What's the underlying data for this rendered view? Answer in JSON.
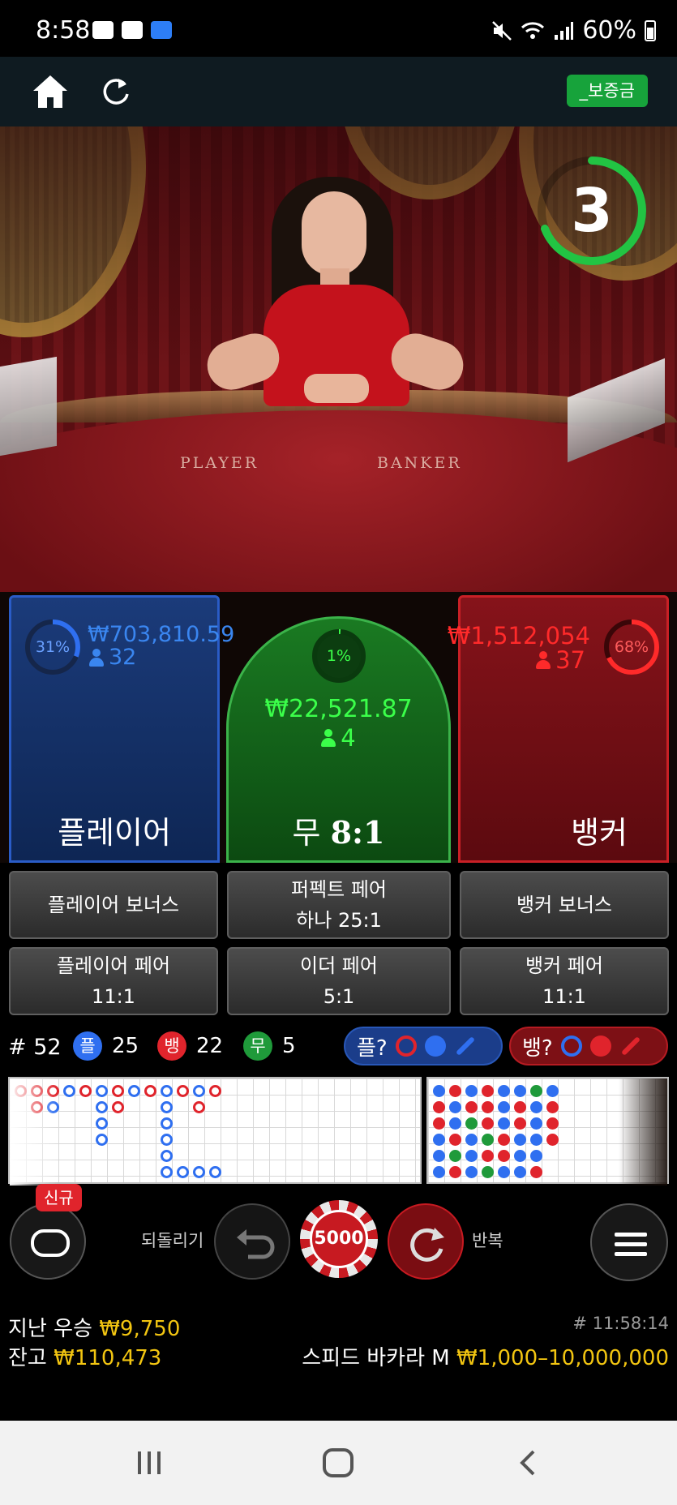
{
  "status_bar": {
    "time": "8:58",
    "battery": "60%"
  },
  "header": {
    "deposit_label": "_보증금"
  },
  "video": {
    "felt_player": "PLAYER",
    "felt_banker": "BANKER",
    "countdown": "3"
  },
  "bets": {
    "player": {
      "percent": "31%",
      "percent_value": 0.31,
      "amount": "₩703,810.59",
      "people": "32",
      "label": "플레이어"
    },
    "tie": {
      "percent": "1%",
      "percent_value": 0.01,
      "amount": "₩22,521.87",
      "people": "4",
      "label": "무",
      "ratio": "8:1"
    },
    "banker": {
      "percent": "68%",
      "percent_value": 0.68,
      "amount": "₩1,512,054",
      "people": "37",
      "label": "뱅커"
    }
  },
  "side_bets": {
    "player_bonus": "플레이어 보너스",
    "perfect_pair_line1": "퍼펙트 페어",
    "perfect_pair_line2": "하나 25:1",
    "banker_bonus": "뱅커 보너스",
    "player_pair_line1": "플레이어 페어",
    "player_pair_line2": "11:1",
    "either_pair_line1": "이더 페어",
    "either_pair_line2": "5:1",
    "banker_pair_line1": "뱅커 페어",
    "banker_pair_line2": "11:1"
  },
  "stats": {
    "round": "# 52",
    "player_glyph": "플",
    "player_count": "25",
    "banker_glyph": "뱅",
    "banker_count": "22",
    "tie_glyph": "무",
    "tie_count": "5",
    "player_ask": "플?",
    "banker_ask": "뱅?"
  },
  "controls": {
    "new_badge": "신규",
    "undo_label": "되돌리기",
    "chip_value": "5000",
    "repeat_label": "반복"
  },
  "info": {
    "last_win_label": "지난 우승",
    "last_win_value": "₩9,750",
    "balance_label": "잔고",
    "balance_value": "₩110,473",
    "game_id": "# 11:58:14",
    "table_name": "스피드 바카라 M",
    "limits": "₩1,000–10,000,000"
  },
  "colors": {
    "player_blue": "#2f6ff0",
    "banker_red": "#e0242c",
    "tie_green": "#1f9a3a",
    "gold": "#f2c511",
    "deposit_green": "#17a33b"
  }
}
